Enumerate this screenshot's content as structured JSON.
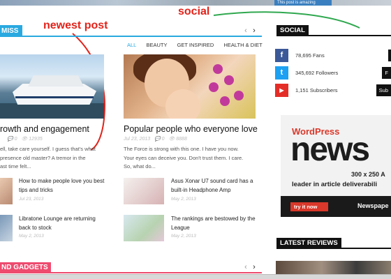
{
  "top_banner": {
    "text": "This post is amazing"
  },
  "annotations": {
    "social": "social",
    "newest_post": "newest post"
  },
  "main": {
    "section_tag": "MISS",
    "filters": [
      "ALL",
      "BEAUTY",
      "GET INSPIRED",
      "HEALTH & DIET"
    ],
    "nav": {
      "prev": "‹",
      "next": "›"
    },
    "post_left": {
      "title": "rowth and engagement",
      "comments": "0",
      "views": "12935",
      "excerpt": [
        "ell, take care yourself. I guess that's what",
        "presence old master? A tremor in the",
        "ast time felt..."
      ]
    },
    "post_right": {
      "title": "Popular people who everyone love",
      "date": "Jul 23, 2013",
      "comments": "0",
      "views": "8888",
      "excerpt": [
        "The Force is strong with this one. I have you now.",
        "Your eyes can deceive you. Don't trust them. I care.",
        "So, what do..."
      ]
    },
    "small_posts": [
      {
        "title": [
          "How to make people love you best",
          "tips and tricks"
        ],
        "date": "Jul 23, 2013"
      },
      {
        "title": [
          "Asus Xonar U7 sound card has a",
          "built-in Headphone Amp"
        ],
        "date": "May 2, 2013"
      },
      {
        "title": [
          "Libratone Lounge are returning",
          "back to stock"
        ],
        "date": "May 2, 2013"
      },
      {
        "title": [
          "The rankings are bestowed by the",
          "League"
        ],
        "date": "May 2, 2013"
      }
    ],
    "gadgets_tag": "ND GADGETS"
  },
  "sidebar": {
    "social_title": "SOCIAL",
    "social": [
      {
        "network": "facebook",
        "icon": "f",
        "count": "78,695 Fans",
        "color": "#3b5998",
        "button": ""
      },
      {
        "network": "twitter",
        "icon": "t",
        "count": "345,692 Followers",
        "color": "#1da1f2",
        "button": "F"
      },
      {
        "network": "youtube",
        "icon": "▶",
        "count": "1,151 Subscribers",
        "color": "#e52d27",
        "button": "Sub"
      }
    ],
    "ad": {
      "brand": "WordPress",
      "headline": "news",
      "size": "300 x 250 A",
      "tagline": "leader in article deliverabili",
      "cta": "try it now",
      "footer": "Newspape"
    },
    "reviews_title": "LATEST REVIEWS"
  },
  "colors": {
    "accent_blue": "#29a9e0",
    "accent_pink": "#ee4b6e",
    "annotation_red": "#e2231a",
    "annotation_green": "#2fa84f"
  }
}
